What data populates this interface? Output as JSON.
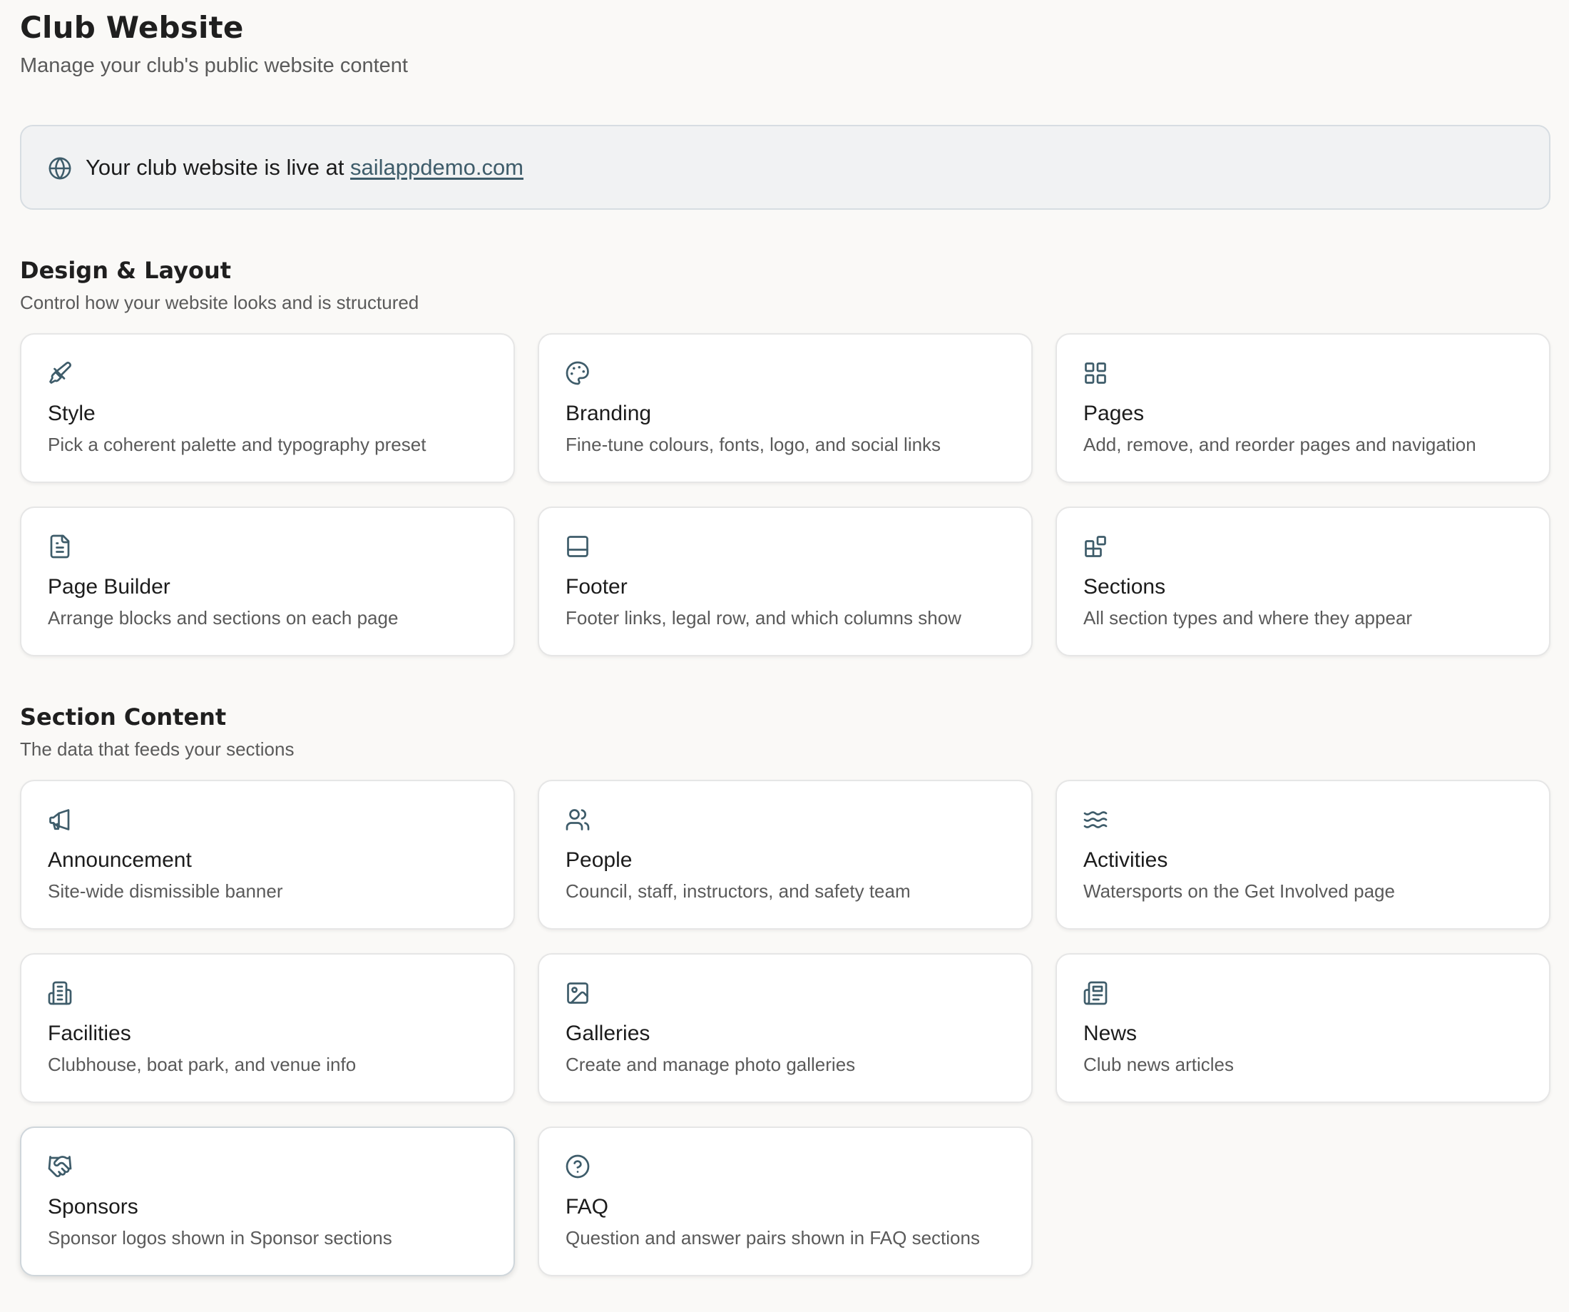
{
  "header": {
    "title": "Club Website",
    "subtitle": "Manage your club's public website content"
  },
  "banner": {
    "icon": "globe-icon",
    "text": "Your club website is live at ",
    "link": "sailappdemo.com"
  },
  "sections": [
    {
      "title": "Design & Layout",
      "description": "Control how your website looks and is structured",
      "cards": [
        {
          "icon": "paintbrush-icon",
          "title": "Style",
          "description": "Pick a coherent palette and typography preset"
        },
        {
          "icon": "palette-icon",
          "title": "Branding",
          "description": "Fine-tune colours, fonts, logo, and social links"
        },
        {
          "icon": "grid-icon",
          "title": "Pages",
          "description": "Add, remove, and reorder pages and navigation"
        },
        {
          "icon": "document-icon",
          "title": "Page Builder",
          "description": "Arrange blocks and sections on each page"
        },
        {
          "icon": "panel-bottom-icon",
          "title": "Footer",
          "description": "Footer links, legal row, and which columns show"
        },
        {
          "icon": "blocks-icon",
          "title": "Sections",
          "description": "All section types and where they appear"
        }
      ]
    },
    {
      "title": "Section Content",
      "description": "The data that feeds your sections",
      "cards": [
        {
          "icon": "megaphone-icon",
          "title": "Announcement",
          "description": "Site-wide dismissible banner"
        },
        {
          "icon": "users-icon",
          "title": "People",
          "description": "Council, staff, instructors, and safety team"
        },
        {
          "icon": "waves-icon",
          "title": "Activities",
          "description": "Watersports on the Get Involved page"
        },
        {
          "icon": "building-icon",
          "title": "Facilities",
          "description": "Clubhouse, boat park, and venue info"
        },
        {
          "icon": "image-icon",
          "title": "Galleries",
          "description": "Create and manage photo galleries"
        },
        {
          "icon": "newspaper-icon",
          "title": "News",
          "description": "Club news articles"
        },
        {
          "icon": "handshake-icon",
          "title": "Sponsors",
          "description": "Sponsor logos shown in Sponsor sections"
        },
        {
          "icon": "help-circle-icon",
          "title": "FAQ",
          "description": "Question and answer pairs shown in FAQ sections"
        }
      ]
    }
  ],
  "colors": {
    "accent": "#3e5c6a",
    "background": "#faf9f7",
    "card": "#ffffff",
    "banner": "#f1f2f3"
  }
}
